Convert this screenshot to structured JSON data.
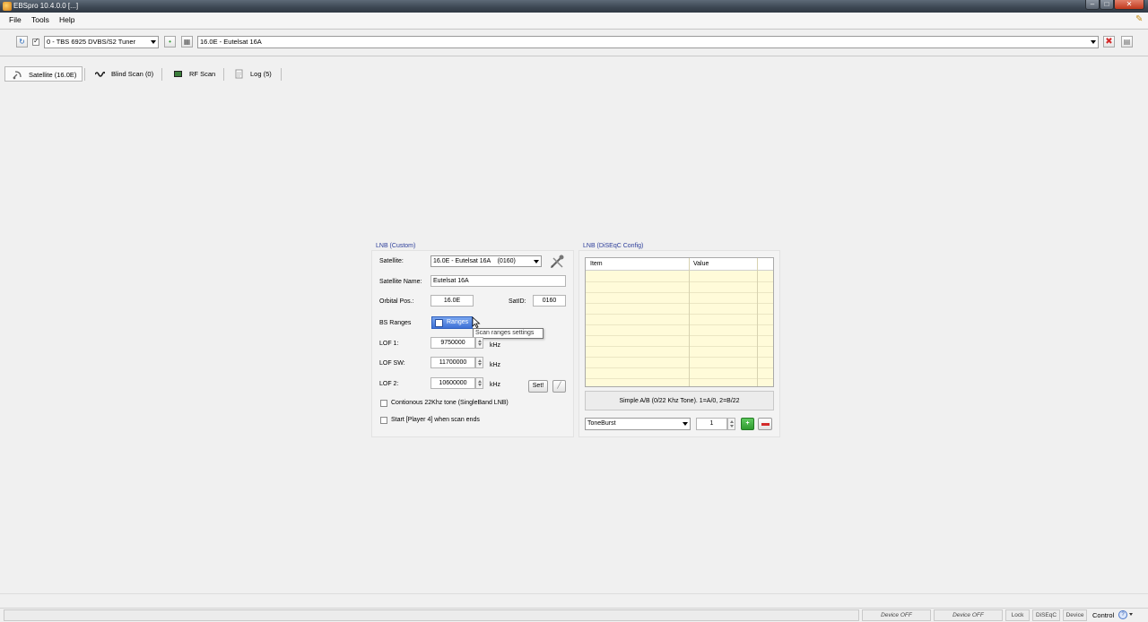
{
  "window": {
    "title": "EBSpro 10.4.0.0 [...]"
  },
  "menu": {
    "file": "File",
    "tools": "Tools",
    "help": "Help"
  },
  "toolbar": {
    "tuner": "0 - TBS 6925 DVBS/S2 Tuner",
    "satellite": "16.0E - Eutelsat 16A"
  },
  "tabs": {
    "satellite": "Satellite (16.0E)",
    "blind_scan": "Blind Scan (0)",
    "rf_scan": "RF Scan",
    "log": "Log (5)"
  },
  "lnb_custom": {
    "title": "LNB (Custom)",
    "satellite_label": "Satellite:",
    "satellite_value": "16.0E - Eutelsat 16A    (0160)",
    "satellite_name_label": "Satellite Name:",
    "satellite_name_value": "Eutelsat 16A",
    "orbital_pos_label": "Orbital Pos.:",
    "orbital_pos_value": "16.0E",
    "satid_label": "SatID:",
    "satid_value": "0160",
    "bs_ranges_label": "BS Ranges",
    "ranges_button": "Ranges",
    "tooltip": "Scan ranges settings",
    "lof1_label": "LOF 1:",
    "lof1_value": "9750000",
    "lofsw_label": "LOF SW:",
    "lofsw_value": "11700000",
    "lof2_label": "LOF 2:",
    "lof2_value": "10600000",
    "unit": "kHz",
    "set_button": "Set!",
    "tone_checkbox": "Contionous 22Khz tone (SingleBand LNB)",
    "player_checkbox": "Start [Player 4] when scan ends"
  },
  "lnb_diseqc": {
    "title": "LNB (DiSEqC Config)",
    "columns": [
      "Item",
      "Value"
    ],
    "description": "Simple A/B (0/22 Khz Tone). 1=A/0, 2=B/22",
    "mode": "ToneBurst",
    "port_value": "1"
  },
  "statusbar": {
    "device_off_1": "Device OFF",
    "device_off_2": "Device OFF",
    "lock": "Lock",
    "diseqc": "DiSEqC",
    "device": "Device",
    "control": "Control"
  },
  "colors": {
    "accent_blue": "#3f72d6",
    "panel_title": "#2c3d9a",
    "grid_bg": "#fffbd9",
    "remove_red": "#d32b2b",
    "add_green": "#2f9b2f"
  }
}
